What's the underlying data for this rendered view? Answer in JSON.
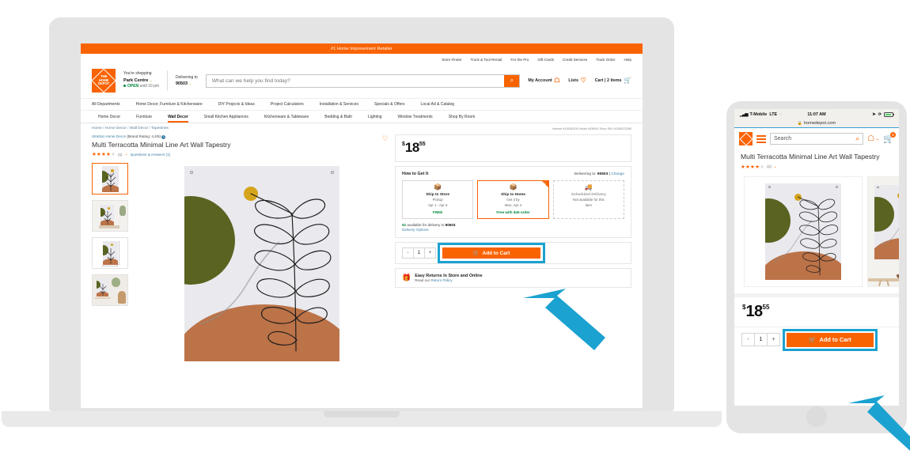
{
  "desktop": {
    "banner": "#1 Home Improvement Retailer",
    "utility_links": [
      "Store Finder",
      "Truck & Tool Rental",
      "For the Pro",
      "Gift Cards",
      "Credit Services",
      "Track Order",
      "Help"
    ],
    "logo_text": "THE HOME DEPOT",
    "store": {
      "shopping_label": "You're shopping",
      "store_name": "Park Centre",
      "open_status": "OPEN",
      "open_until": "until 10 pm"
    },
    "delivery": {
      "label": "Delivering to",
      "zip": "90503"
    },
    "search_placeholder": "What can we help you find today?",
    "search_icon": "search-icon",
    "actions": [
      {
        "label": "My Account",
        "icon": "person-icon"
      },
      {
        "label": "Lists",
        "icon": "heart-icon"
      },
      {
        "label": "Cart | 2 items",
        "icon": "cart-icon"
      }
    ],
    "nav_primary": [
      "All Departments",
      "Home Decor, Furniture & Kitchenware",
      "DIY Projects & Ideas",
      "Project Calculators",
      "Installation & Services",
      "Specials & Offers",
      "Local Ad & Catalog"
    ],
    "nav_secondary": [
      "Home Decor",
      "Furniture",
      "Wall Decor",
      "Small Kitchen Appliances",
      "Kitchenware & Tableware",
      "Bedding & Bath",
      "Lighting",
      "Window Treatments",
      "Shop By Room"
    ],
    "nav_secondary_active": "Wall Decor",
    "breadcrumb": [
      "Home",
      "Home Decor",
      "Wall Decor",
      "Tapestries"
    ],
    "ids_line": "Internet #316382044   Model #536941   Store SKU #1008223286",
    "product": {
      "brand": "Stratton Home Decor",
      "brand_rating": "(Brand Rating: 4.4/5)",
      "title": "Multi Terracotta Minimal Line Art Wall Tapestry",
      "stars_filled": 4,
      "review_count": "(1)",
      "qa_link": "Questions & Answers (1)",
      "wishlist_icon": "heart-icon"
    },
    "price": {
      "currency": "$",
      "dollars": "18",
      "cents": "55"
    },
    "how_to_get_it": {
      "heading": "How to Get It",
      "delivering_label": "Delivering to:",
      "delivering_zip": "90503",
      "change_link": "Change",
      "options": [
        {
          "icon": "store-box-icon",
          "title": "Ship to Store",
          "sub1": "Pickup",
          "sub2": "Apr 1 - Apr 6",
          "tag": "FREE",
          "selected": false
        },
        {
          "icon": "box-icon",
          "title": "Ship to Home",
          "sub1": "Get it by",
          "sub2": "Mon, Apr 4",
          "tag": "Free with $45 order",
          "selected": true
        },
        {
          "icon": "truck-icon",
          "title": "Scheduled Delivery",
          "sub1": "Not available for this",
          "sub2": "item",
          "tag": "",
          "selected": false
        }
      ],
      "availability_count": "52",
      "availability_text": "available for delivery to",
      "availability_zip": "90503",
      "delivery_options_link": "Delivery Options"
    },
    "cart": {
      "minus": "-",
      "quantity": "1",
      "plus": "+",
      "add_to_cart": "Add to Cart",
      "cart_icon": "cart-icon"
    },
    "returns": {
      "icon": "returns-box-icon",
      "title": "Easy Returns In Store and Online",
      "sub_prefix": "Read our ",
      "sub_link": "Return Policy"
    }
  },
  "mobile": {
    "status": {
      "carrier": "T-Mobile",
      "network": "LTE",
      "time": "11:07 AM",
      "signal_icon": "signal-bars-icon",
      "wifi_icon": "wifi-icon",
      "location_icon": "location-arrow-icon",
      "rotation_icon": "rotation-lock-icon",
      "battery_icon": "battery-icon"
    },
    "url": "homedepot.com",
    "lock_icon": "lock-icon",
    "header": {
      "logo_icon": "home-depot-logo-icon",
      "menu_icon": "hamburger-menu-icon",
      "search_placeholder": "Search",
      "search_icon": "search-icon",
      "account_icon": "person-icon",
      "cart_icon": "cart-icon",
      "cart_badge": "2"
    },
    "product": {
      "title": "Multi Terracotta Minimal Line Art Wall Tapestry",
      "stars_filled": 4,
      "review_count": "(1)"
    },
    "price": {
      "currency": "$",
      "dollars": "18",
      "cents": "55"
    },
    "cart": {
      "minus": "-",
      "quantity": "1",
      "plus": "+",
      "add_to_cart": "Add to Cart",
      "cart_icon": "cart-icon"
    }
  },
  "annotations": {
    "highlight_color": "#1ba2d0",
    "brand_orange": "#f96302",
    "arrow_desktop": "arrow-pointing-to-desktop-add-to-cart",
    "arrow_mobile": "arrow-pointing-to-mobile-add-to-cart"
  }
}
